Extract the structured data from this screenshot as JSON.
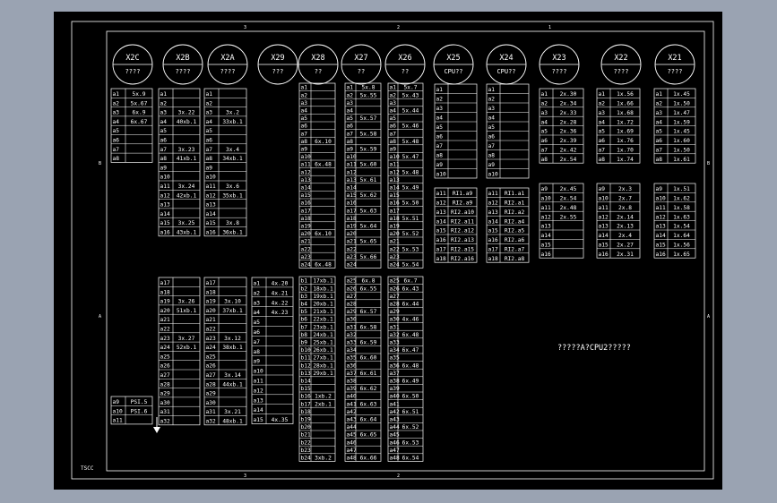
{
  "theme": {
    "bg_outer": "#9aa3b2",
    "bg_sheet": "#000000",
    "line": "#ffffff"
  },
  "margin_ticks": {
    "top": [
      "3",
      "2",
      "1"
    ],
    "bottom": [
      "3",
      "2"
    ],
    "left": [
      "B",
      "A"
    ],
    "right": [
      "B",
      "A"
    ]
  },
  "drawing_code": "TSCC",
  "note": "?????A?CPU2?????",
  "connectors": [
    {
      "name": "X2C",
      "sub": "????"
    },
    {
      "name": "X2B",
      "sub": "????"
    },
    {
      "name": "X2A",
      "sub": "????"
    },
    {
      "name": "X29",
      "sub": "???"
    },
    {
      "name": "X28",
      "sub": "??"
    },
    {
      "name": "X27",
      "sub": "??"
    },
    {
      "name": "X26",
      "sub": "??"
    },
    {
      "name": "X25",
      "sub": "CPU??"
    },
    {
      "name": "X24",
      "sub": "CPU??"
    },
    {
      "name": "X23",
      "sub": "????"
    },
    {
      "name": "X22",
      "sub": "????"
    },
    {
      "name": "X21",
      "sub": "????"
    }
  ],
  "tables": [
    {
      "id": "x2c-top",
      "rows": [
        [
          "a1",
          "5x.9"
        ],
        [
          "a2",
          "5x.67"
        ],
        [
          "a3",
          "6x.9"
        ],
        [
          "a4",
          "6x.67"
        ],
        [
          "a5",
          ""
        ],
        [
          "a6",
          ""
        ],
        [
          "a7",
          ""
        ],
        [
          "a8",
          ""
        ]
      ]
    },
    {
      "id": "x2c-bot",
      "rows": [
        [
          "a9",
          "PSI.5"
        ],
        [
          "a10",
          "PSI.6"
        ],
        [
          "a11",
          ""
        ]
      ]
    },
    {
      "id": "x2b-top",
      "rows": [
        [
          "a1",
          ""
        ],
        [
          "a2",
          ""
        ],
        [
          "a3",
          "3x.22"
        ],
        [
          "a4",
          "40xb.1"
        ],
        [
          "a5",
          ""
        ],
        [
          "a6",
          ""
        ],
        [
          "a7",
          "3x.23"
        ],
        [
          "a8",
          "41xb.1"
        ],
        [
          "a9",
          ""
        ],
        [
          "a10",
          ""
        ],
        [
          "a11",
          "3x.24"
        ],
        [
          "a12",
          "42xb.1"
        ],
        [
          "a13",
          ""
        ],
        [
          "a14",
          ""
        ],
        [
          "a15",
          "3x.25"
        ],
        [
          "a16",
          "43xb.1"
        ]
      ]
    },
    {
      "id": "x2b-bot",
      "rows": [
        [
          "a17",
          ""
        ],
        [
          "a18",
          ""
        ],
        [
          "a19",
          "3x.26"
        ],
        [
          "a20",
          "51xb.1"
        ],
        [
          "a21",
          ""
        ],
        [
          "a22",
          ""
        ],
        [
          "a23",
          "3x.27"
        ],
        [
          "a24",
          "52xb.1"
        ],
        [
          "a25",
          ""
        ],
        [
          "a26",
          ""
        ],
        [
          "a27",
          ""
        ],
        [
          "a28",
          ""
        ],
        [
          "a29",
          ""
        ],
        [
          "a30",
          ""
        ],
        [
          "a31",
          ""
        ],
        [
          "a32",
          ""
        ]
      ]
    },
    {
      "id": "x2a-top",
      "rows": [
        [
          "a1",
          ""
        ],
        [
          "a2",
          ""
        ],
        [
          "a3",
          "3x.2"
        ],
        [
          "a4",
          "33xb.1"
        ],
        [
          "a5",
          ""
        ],
        [
          "a6",
          ""
        ],
        [
          "a7",
          "3x.4"
        ],
        [
          "a8",
          "34xb.1"
        ],
        [
          "a9",
          ""
        ],
        [
          "a10",
          ""
        ],
        [
          "a11",
          "3x.6"
        ],
        [
          "a12",
          "35xb.1"
        ],
        [
          "a13",
          ""
        ],
        [
          "a14",
          ""
        ],
        [
          "a15",
          "3x.8"
        ],
        [
          "a16",
          "36xb.1"
        ]
      ]
    },
    {
      "id": "x2a-bot",
      "rows": [
        [
          "a17",
          ""
        ],
        [
          "a18",
          ""
        ],
        [
          "a19",
          "3x.10"
        ],
        [
          "a20",
          "37xb.1"
        ],
        [
          "a21",
          ""
        ],
        [
          "a22",
          ""
        ],
        [
          "a23",
          "3x.12"
        ],
        [
          "a24",
          "38xb.1"
        ],
        [
          "a25",
          ""
        ],
        [
          "a26",
          ""
        ],
        [
          "a27",
          "3x.14"
        ],
        [
          "a28",
          "44xb.1"
        ],
        [
          "a29",
          ""
        ],
        [
          "a30",
          ""
        ],
        [
          "a31",
          "3x.21"
        ],
        [
          "a32",
          "48xb.1"
        ]
      ]
    },
    {
      "id": "x29-bot",
      "rows": [
        [
          "a1",
          "4x.20"
        ],
        [
          "a2",
          "4x.21"
        ],
        [
          "a3",
          "4x.22"
        ],
        [
          "a4",
          "4x.23"
        ],
        [
          "a5",
          ""
        ],
        [
          "a6",
          ""
        ],
        [
          "a7",
          ""
        ],
        [
          "a8",
          ""
        ],
        [
          "a9",
          ""
        ],
        [
          "a10",
          ""
        ],
        [
          "a11",
          ""
        ],
        [
          "a12",
          ""
        ],
        [
          "a13",
          ""
        ],
        [
          "a14",
          ""
        ],
        [
          "a15",
          "4x.35"
        ]
      ]
    },
    {
      "id": "x28-top",
      "rows": [
        [
          "a1",
          ""
        ],
        [
          "a2",
          ""
        ],
        [
          "a3",
          ""
        ],
        [
          "a4",
          ""
        ],
        [
          "a5",
          ""
        ],
        [
          "a6",
          ""
        ],
        [
          "a7",
          ""
        ],
        [
          "a8",
          "6x.10"
        ],
        [
          "a9",
          ""
        ],
        [
          "a10",
          ""
        ],
        [
          "a11",
          "6x.48"
        ],
        [
          "a12",
          ""
        ],
        [
          "a13",
          ""
        ],
        [
          "a14",
          ""
        ],
        [
          "a15",
          ""
        ],
        [
          "a16",
          ""
        ],
        [
          "a17",
          ""
        ],
        [
          "a18",
          ""
        ],
        [
          "a19",
          ""
        ],
        [
          "a20",
          "6x.10"
        ],
        [
          "a21",
          ""
        ],
        [
          "a22",
          ""
        ],
        [
          "a23",
          ""
        ],
        [
          "a24",
          "6x.48"
        ]
      ]
    },
    {
      "id": "x28-bot",
      "rows": [
        [
          "b1",
          "17xb.1"
        ],
        [
          "b2",
          "18xb.1"
        ],
        [
          "b3",
          "19xb.1"
        ],
        [
          "b4",
          "20xb.1"
        ],
        [
          "b5",
          "21xb.1"
        ],
        [
          "b6",
          "22xb.1"
        ],
        [
          "b7",
          "23xb.1"
        ],
        [
          "b8",
          "24xb.1"
        ],
        [
          "b9",
          "25xb.1"
        ],
        [
          "b10",
          "26xb.1"
        ],
        [
          "b11",
          "27xb.1"
        ],
        [
          "b12",
          "28xb.1"
        ],
        [
          "b13",
          "29xb.1"
        ],
        [
          "b14",
          ""
        ],
        [
          "b15",
          ""
        ],
        [
          "b16",
          "1xb.2"
        ],
        [
          "b17",
          "2xb.1"
        ],
        [
          "b18",
          ""
        ],
        [
          "b19",
          ""
        ],
        [
          "b20",
          ""
        ],
        [
          "b21",
          ""
        ],
        [
          "b22",
          ""
        ],
        [
          "b23",
          ""
        ],
        [
          "b24",
          "3xb.2"
        ]
      ]
    },
    {
      "id": "x27-top",
      "rows": [
        [
          "a1",
          "5x.8"
        ],
        [
          "a2",
          "5x.55"
        ],
        [
          "a3",
          ""
        ],
        [
          "a4",
          ""
        ],
        [
          "a5",
          "5x.57"
        ],
        [
          "a6",
          ""
        ],
        [
          "a7",
          "5x.58"
        ],
        [
          "a8",
          ""
        ],
        [
          "a9",
          "5x.59"
        ],
        [
          "a10",
          ""
        ],
        [
          "a11",
          "5x.60"
        ],
        [
          "a12",
          ""
        ],
        [
          "a13",
          "5x.61"
        ],
        [
          "a14",
          ""
        ],
        [
          "a15",
          "5x.62"
        ],
        [
          "a16",
          ""
        ],
        [
          "a17",
          "5x.63"
        ],
        [
          "a18",
          ""
        ],
        [
          "a19",
          "5x.64"
        ],
        [
          "a20",
          ""
        ],
        [
          "a21",
          "5x.65"
        ],
        [
          "a22",
          ""
        ],
        [
          "a23",
          "5x.66"
        ],
        [
          "a24",
          ""
        ]
      ]
    },
    {
      "id": "x27-bot",
      "rows": [
        [
          "a25",
          "6x.8"
        ],
        [
          "a26",
          "6x.55"
        ],
        [
          "a27",
          ""
        ],
        [
          "a28",
          ""
        ],
        [
          "a29",
          "6x.57"
        ],
        [
          "a30",
          ""
        ],
        [
          "a31",
          "6x.58"
        ],
        [
          "a32",
          ""
        ],
        [
          "a33",
          "6x.59"
        ],
        [
          "a34",
          ""
        ],
        [
          "a35",
          "6x.60"
        ],
        [
          "a36",
          ""
        ],
        [
          "a37",
          "6x.61"
        ],
        [
          "a38",
          ""
        ],
        [
          "a39",
          "6x.62"
        ],
        [
          "a40",
          ""
        ],
        [
          "a41",
          "6x.63"
        ],
        [
          "a42",
          ""
        ],
        [
          "a43",
          "6x.64"
        ],
        [
          "a44",
          ""
        ],
        [
          "a45",
          "6x.65"
        ],
        [
          "a46",
          ""
        ],
        [
          "a47",
          ""
        ],
        [
          "a48",
          "6x.66"
        ]
      ]
    },
    {
      "id": "x26-top",
      "rows": [
        [
          "a1",
          "5x.7"
        ],
        [
          "a2",
          "5x.43"
        ],
        [
          "a3",
          ""
        ],
        [
          "a4",
          "5x.44"
        ],
        [
          "a5",
          ""
        ],
        [
          "a6",
          "5x.46"
        ],
        [
          "a7",
          ""
        ],
        [
          "a8",
          "5x.48"
        ],
        [
          "a9",
          ""
        ],
        [
          "a10",
          "5x.47"
        ],
        [
          "a11",
          ""
        ],
        [
          "a12",
          "5x.48"
        ],
        [
          "a13",
          ""
        ],
        [
          "a14",
          "5x.49"
        ],
        [
          "a15",
          ""
        ],
        [
          "a16",
          "5x.50"
        ],
        [
          "a17",
          ""
        ],
        [
          "a18",
          "5x.51"
        ],
        [
          "a19",
          ""
        ],
        [
          "a20",
          "5x.52"
        ],
        [
          "a21",
          ""
        ],
        [
          "a22",
          "5x.53"
        ],
        [
          "a23",
          ""
        ],
        [
          "a24",
          "5x.54"
        ]
      ]
    },
    {
      "id": "x26-bot",
      "rows": [
        [
          "a25",
          "6x.7"
        ],
        [
          "a26",
          "6x.43"
        ],
        [
          "a27",
          ""
        ],
        [
          "a28",
          "6x.44"
        ],
        [
          "a29",
          ""
        ],
        [
          "a30",
          "4x.46"
        ],
        [
          "a31",
          ""
        ],
        [
          "a32",
          "6x.48"
        ],
        [
          "a33",
          ""
        ],
        [
          "a34",
          "6x.47"
        ],
        [
          "a35",
          ""
        ],
        [
          "a36",
          "6x.48"
        ],
        [
          "a37",
          ""
        ],
        [
          "a38",
          "6x.49"
        ],
        [
          "a39",
          ""
        ],
        [
          "a40",
          "6x.50"
        ],
        [
          "a41",
          ""
        ],
        [
          "a42",
          "6x.51"
        ],
        [
          "a43",
          ""
        ],
        [
          "a44",
          "6x.52"
        ],
        [
          "a45",
          ""
        ],
        [
          "a46",
          "6x.53"
        ],
        [
          "a47",
          ""
        ],
        [
          "a48",
          "6x.54"
        ]
      ]
    },
    {
      "id": "x25-top",
      "rows": [
        [
          "a1",
          ""
        ],
        [
          "a2",
          ""
        ],
        [
          "a3",
          ""
        ],
        [
          "a4",
          ""
        ],
        [
          "a5",
          ""
        ],
        [
          "a6",
          ""
        ],
        [
          "a7",
          ""
        ],
        [
          "a8",
          ""
        ],
        [
          "a9",
          ""
        ],
        [
          "a10",
          ""
        ]
      ]
    },
    {
      "id": "x25-mid",
      "rows": [
        [
          "a11",
          "RI1.a9"
        ],
        [
          "a12",
          "RI2.a9"
        ],
        [
          "a13",
          "RI2.a10"
        ],
        [
          "a14",
          "RI2.a11"
        ],
        [
          "a15",
          "RI2.a12"
        ],
        [
          "a16",
          "RI2.a13"
        ],
        [
          "a17",
          "RI2.a15"
        ],
        [
          "a18",
          "RI2.a16"
        ]
      ]
    },
    {
      "id": "x24-top",
      "rows": [
        [
          "a1",
          ""
        ],
        [
          "a2",
          ""
        ],
        [
          "a3",
          ""
        ],
        [
          "a4",
          ""
        ],
        [
          "a5",
          ""
        ],
        [
          "a6",
          ""
        ],
        [
          "a7",
          ""
        ],
        [
          "a8",
          ""
        ],
        [
          "a9",
          ""
        ],
        [
          "a10",
          ""
        ]
      ]
    },
    {
      "id": "x24-mid",
      "rows": [
        [
          "a11",
          "RI1.a1"
        ],
        [
          "a12",
          "RI2.a1"
        ],
        [
          "a13",
          "RI2.a2"
        ],
        [
          "a14",
          "RI2.a4"
        ],
        [
          "a15",
          "RI2.a5"
        ],
        [
          "a16",
          "RI2.a6"
        ],
        [
          "a17",
          "RI2.a7"
        ],
        [
          "a18",
          "RI2.a8"
        ]
      ]
    },
    {
      "id": "x23-top",
      "rows": [
        [
          "a1",
          "2x.30"
        ],
        [
          "a2",
          "2x.34"
        ],
        [
          "a3",
          "2x.33"
        ],
        [
          "a4",
          "2x.28"
        ],
        [
          "a5",
          "2x.36"
        ],
        [
          "a6",
          "2x.39"
        ],
        [
          "a7",
          "2x.42"
        ],
        [
          "a8",
          "2x.54"
        ]
      ]
    },
    {
      "id": "x23-mid",
      "rows": [
        [
          "a9",
          "2x.45"
        ],
        [
          "a10",
          "2x.54"
        ],
        [
          "a11",
          "2x.48"
        ],
        [
          "a12",
          "2x.55"
        ],
        [
          "a13",
          ""
        ],
        [
          "a14",
          ""
        ],
        [
          "a15",
          ""
        ],
        [
          "a16",
          ""
        ]
      ]
    },
    {
      "id": "x22-top",
      "rows": [
        [
          "a1",
          "1x.56"
        ],
        [
          "a2",
          "1x.66"
        ],
        [
          "a3",
          "1x.68"
        ],
        [
          "a4",
          "1x.72"
        ],
        [
          "a5",
          "1x.69"
        ],
        [
          "a6",
          "1x.76"
        ],
        [
          "a7",
          "1x.70"
        ],
        [
          "a8",
          "1x.74"
        ]
      ]
    },
    {
      "id": "x22-mid",
      "rows": [
        [
          "a9",
          "2x.3"
        ],
        [
          "a10",
          "2x.7"
        ],
        [
          "a11",
          "2x.8"
        ],
        [
          "a12",
          "2x.14"
        ],
        [
          "a13",
          "2x.13"
        ],
        [
          "a14",
          "2x.4"
        ],
        [
          "a15",
          "2x.27"
        ],
        [
          "a16",
          "2x.31"
        ]
      ]
    },
    {
      "id": "x21-top",
      "rows": [
        [
          "a1",
          "1x.45"
        ],
        [
          "a2",
          "1x.50"
        ],
        [
          "a3",
          "1x.47"
        ],
        [
          "a4",
          "1x.59"
        ],
        [
          "a5",
          "1x.45"
        ],
        [
          "a6",
          "1x.60"
        ],
        [
          "a7",
          "1x.50"
        ],
        [
          "a8",
          "1x.61"
        ]
      ]
    },
    {
      "id": "x21-mid",
      "rows": [
        [
          "a9",
          "1x.51"
        ],
        [
          "a10",
          "1x.62"
        ],
        [
          "a11",
          "1x.58"
        ],
        [
          "a12",
          "1x.63"
        ],
        [
          "a13",
          "1x.54"
        ],
        [
          "a14",
          "1x.64"
        ],
        [
          "a15",
          "1x.56"
        ],
        [
          "a16",
          "1x.65"
        ]
      ]
    }
  ]
}
